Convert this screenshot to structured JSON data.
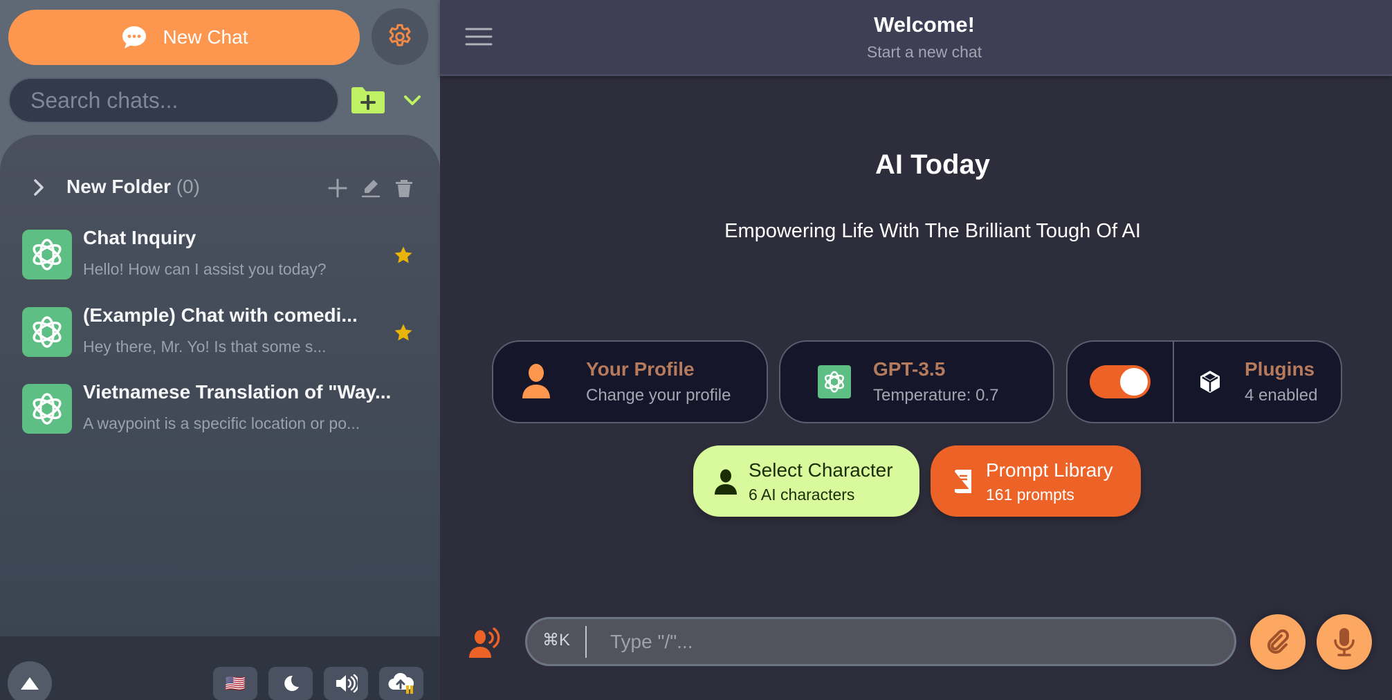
{
  "sidebar": {
    "new_chat_label": "New Chat",
    "search_placeholder": "Search chats...",
    "search_value": "",
    "folder": {
      "name": "New Folder",
      "count": "(0)"
    },
    "chats": [
      {
        "title": "Chat Inquiry",
        "preview": "Hello! How can I assist you today?",
        "starred": true
      },
      {
        "title": "(Example) Chat with comedi...",
        "preview": "Hey there, Mr. Yo! Is that some s...",
        "starred": true
      },
      {
        "title": "Vietnamese Translation of \"Way...",
        "preview": "A waypoint is a specific location or po...",
        "starred": false
      }
    ],
    "bottom_tools": {
      "language_flag": "🇺🇸",
      "theme_icon": "moon-icon",
      "sound_icon": "speaker-icon",
      "sync_icon": "cloud-upload-icon"
    }
  },
  "header": {
    "title": "Welcome!",
    "subtitle": "Start a new chat"
  },
  "hero": {
    "title": "AI Today",
    "subtitle": "Empowering Life With The Brilliant Tough Of AI"
  },
  "cards": {
    "profile": {
      "title": "Your Profile",
      "subtitle": "Change your profile"
    },
    "model": {
      "title": "GPT-3.5",
      "subtitle": "Temperature: 0.7"
    },
    "plugins": {
      "title": "Plugins",
      "subtitle": "4 enabled",
      "toggle_on": true
    }
  },
  "actions": {
    "character": {
      "title": "Select Character",
      "subtitle": "6 AI characters"
    },
    "prompts": {
      "title": "Prompt Library",
      "subtitle": "161 prompts"
    }
  },
  "composer": {
    "shortcut": "⌘K",
    "placeholder": "Type \"/\"...",
    "value": ""
  },
  "colors": {
    "accent_orange": "#fd964e",
    "accent_red_orange": "#ed6327",
    "accent_lime": "#d9f99d",
    "openai_green": "#5dbf83",
    "star_gold": "#eab308"
  }
}
